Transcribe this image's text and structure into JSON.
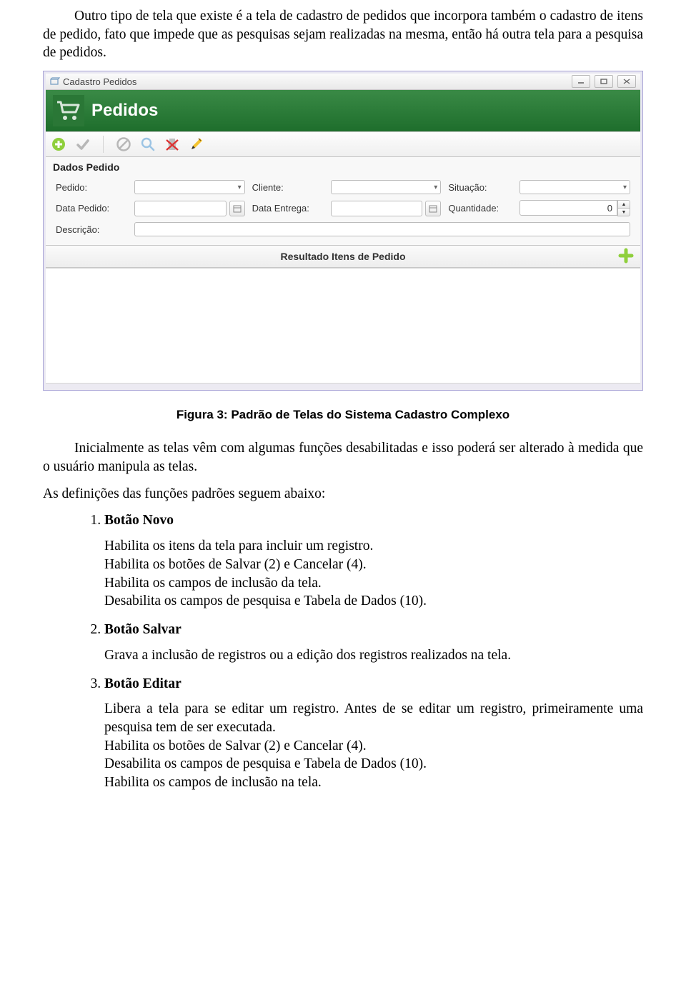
{
  "intro": "Outro tipo de tela que existe é a tela de cadastro de pedidos que incorpora também o cadastro de itens de pedido, fato que impede que as pesquisas sejam realizadas na mesma, então há outra tela para a pesquisa de pedidos.",
  "caption": "Figura 3: Padrão de Telas do Sistema Cadastro Complexo",
  "para2": "Inicialmente as telas vêm com algumas funções desabilitadas e isso poderá ser alterado à medida que o usuário manipula as telas.",
  "para3": "As definições das funções padrões seguem abaixo:",
  "items": [
    {
      "title": "Botão Novo",
      "body": "Habilita os itens da tela para incluir um registro.\nHabilita os botões de Salvar (2) e Cancelar (4).\nHabilita os campos de inclusão da tela.\nDesabilita os campos de pesquisa e Tabela de Dados (10)."
    },
    {
      "title": "Botão Salvar",
      "body": "Grava a inclusão de registros ou a edição dos registros realizados na tela."
    },
    {
      "title": "Botão Editar",
      "body": "Libera a tela para se editar um registro. Antes de se editar um registro, primeiramente uma pesquisa tem de ser executada.\nHabilita os botões de Salvar (2) e Cancelar (4).\nDesabilita os campos de pesquisa e Tabela de Dados (10).\nHabilita os campos de inclusão na tela."
    }
  ],
  "win": {
    "title": "Cadastro Pedidos",
    "banner": "Pedidos",
    "section": "Dados Pedido",
    "labels": {
      "pedido": "Pedido:",
      "cliente": "Cliente:",
      "situacao": "Situação:",
      "dataPedido": "Data Pedido:",
      "dataEntrega": "Data Entrega:",
      "quantidade": "Quantidade:",
      "descricao": "Descrição:"
    },
    "qty": "0",
    "subheader": "Resultado Itens de Pedido"
  }
}
